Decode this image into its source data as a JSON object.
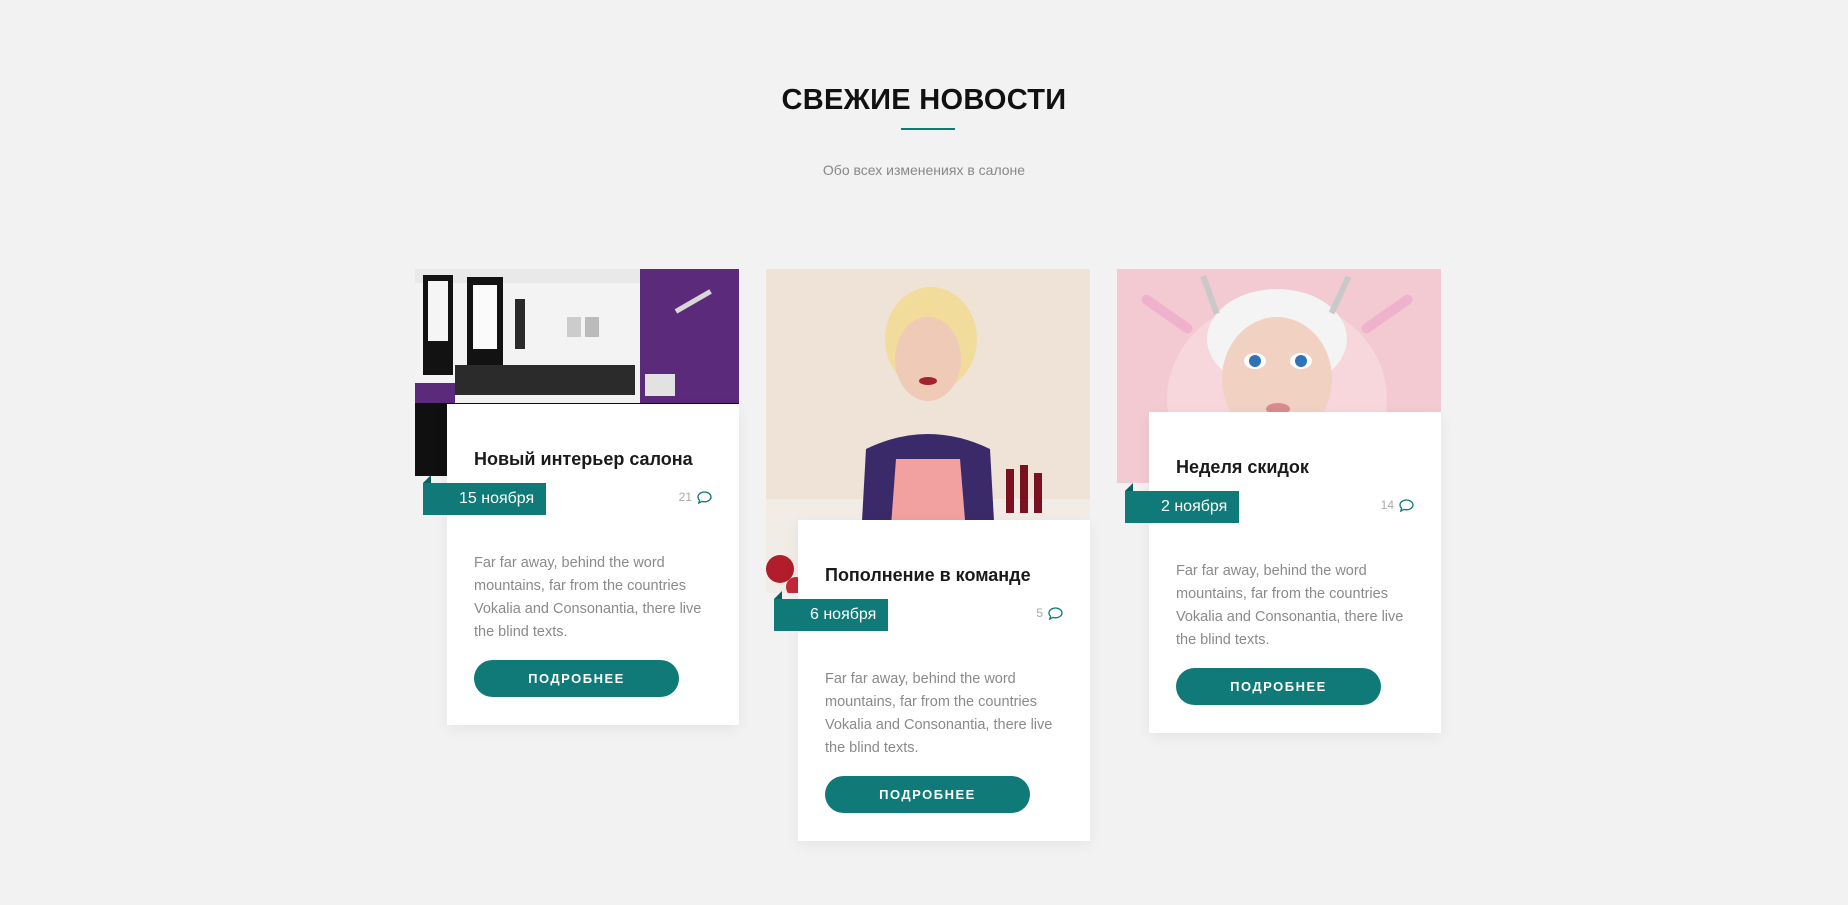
{
  "section": {
    "title": "СВЕЖИЕ НОВОСТИ",
    "subtitle": "Обо всех изменениях в салоне"
  },
  "colors": {
    "accent": "#0f7a78",
    "background": "#f2f2f2",
    "card": "#ffffff"
  },
  "posts": [
    {
      "title": "Новый интерьер салона",
      "date": "15 ноября",
      "comments": "21",
      "text": "Far far away, behind the word mountains, far from the countries Vokalia and Consonantia, there live the blind texts.",
      "button": "ПОДРОБНЕЕ"
    },
    {
      "title": "Пополнение в команде",
      "date": "6 ноября",
      "comments": "5",
      "text": "Far far away, behind the word mountains, far from the countries Vokalia and Consonantia, there live the blind texts.",
      "button": "ПОДРОБНЕЕ"
    },
    {
      "title": "Неделя скидок",
      "date": "2 ноября",
      "comments": "14",
      "text": "Far far away, behind the word mountains, far from the countries Vokalia and Consonantia, there live the blind texts.",
      "button": "ПОДРОБНЕЕ"
    }
  ]
}
